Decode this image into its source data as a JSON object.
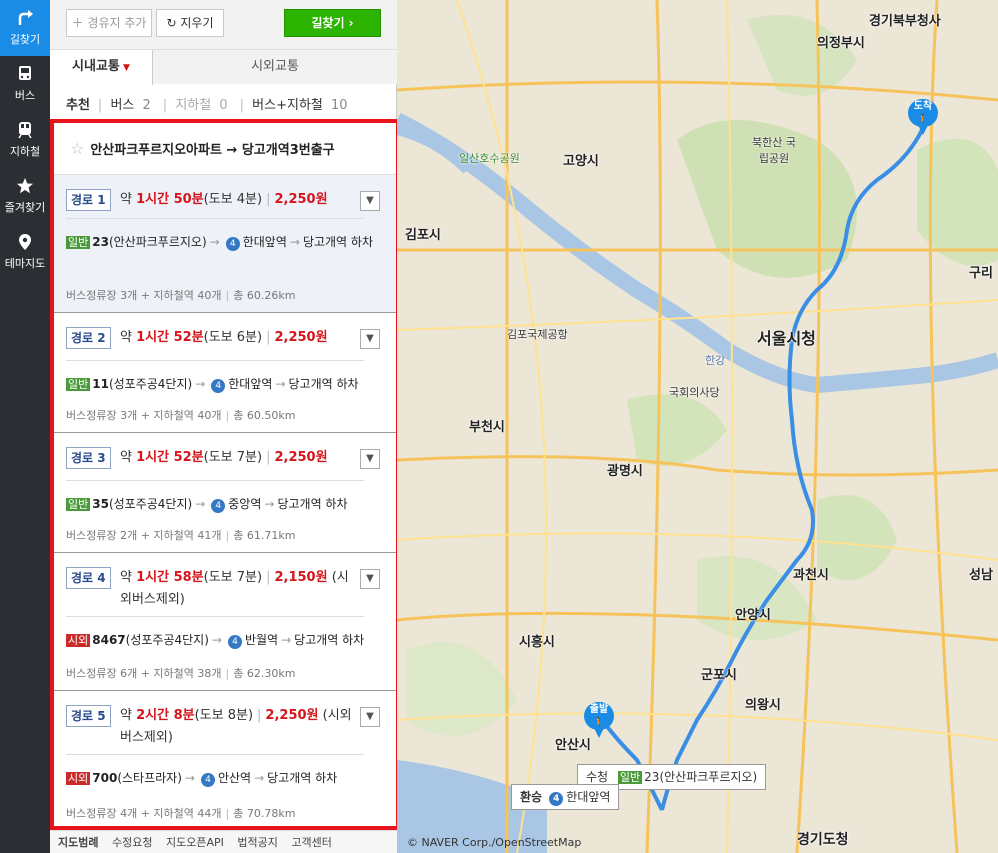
{
  "nav": {
    "items": [
      {
        "label": "길찾기",
        "icon": "route-icon"
      },
      {
        "label": "버스",
        "icon": "bus-icon"
      },
      {
        "label": "지하철",
        "icon": "subway-icon"
      },
      {
        "label": "즐겨찾기",
        "icon": "star-icon"
      },
      {
        "label": "테마지도",
        "icon": "map-pin-icon"
      }
    ]
  },
  "toolbar": {
    "waypoint": "경유지 추가",
    "clear": "지우기",
    "search": "길찾기"
  },
  "tabs": {
    "city": "시내교통",
    "intercity": "시외교통"
  },
  "subtabs": {
    "recommend": "추천",
    "bus_label": "버스",
    "bus_count": "2",
    "subway_label": "지하철",
    "subway_count": "0",
    "busSubway_label": "버스+지하철",
    "busSubway_count": "10"
  },
  "results": {
    "header": "안산파크푸르지오아파트 → 당고개역3번출구",
    "routes": [
      {
        "tag": "경로 1",
        "prefix": "약 ",
        "time": "1시간 50분",
        "walk": "(도보 4분)",
        "fare": "2,250원",
        "extra": "",
        "busType": "일반",
        "busNo": "23",
        "busStop": "(안산파크푸르지오)",
        "line": "4",
        "station": "한대앞역",
        "dest": "당고개역 하차",
        "info1": "버스정류장 3개 + 지하철역 40개",
        "info2": "총 60.26km"
      },
      {
        "tag": "경로 2",
        "prefix": "약 ",
        "time": "1시간 52분",
        "walk": "(도보 6분)",
        "fare": "2,250원",
        "extra": "",
        "busType": "일반",
        "busNo": "11",
        "busStop": "(성포주공4단지)",
        "line": "4",
        "station": "한대앞역",
        "dest": "당고개역 하차",
        "info1": "버스정류장 3개 + 지하철역 40개",
        "info2": "총 60.50km"
      },
      {
        "tag": "경로 3",
        "prefix": "약 ",
        "time": "1시간 52분",
        "walk": "(도보 7분)",
        "fare": "2,250원",
        "extra": "",
        "busType": "일반",
        "busNo": "35",
        "busStop": "(성포주공4단지)",
        "line": "4",
        "station": "중앙역",
        "dest": "당고개역 하차",
        "info1": "버스정류장 2개 + 지하철역 41개",
        "info2": "총 61.71km"
      },
      {
        "tag": "경로 4",
        "prefix": "약 ",
        "time": "1시간 58분",
        "walk": "(도보 7분)",
        "fare": "2,150원",
        "extra": " (시외버스제외)",
        "busType": "시외",
        "busNo": "8467",
        "busStop": "(성포주공4단지)",
        "line": "4",
        "station": "반월역",
        "dest": "당고개역 하차",
        "info1": "버스정류장 6개 + 지하철역 38개",
        "info2": "총 62.30km"
      },
      {
        "tag": "경로 5",
        "prefix": "약 ",
        "time": "2시간 8분",
        "walk": "(도보 8분)",
        "fare": "2,250원",
        "extra": " (시외버스제외)",
        "busType": "시외",
        "busNo": "700",
        "busStop": "(스타프라자)",
        "line": "4",
        "station": "안산역",
        "dest": "당고개역 하차",
        "info1": "버스정류장 4개 + 지하철역 44개",
        "info2": "총 70.78km"
      }
    ]
  },
  "footer": {
    "legend": "지도범례",
    "edit": "수정요청",
    "api": "지도오픈API",
    "legal": "법적공지",
    "support": "고객센터"
  },
  "map": {
    "arrive": "도착",
    "depart": "출발",
    "transfer_label": "환승",
    "transfer_line": "4",
    "transfer_station": "한대앞역",
    "start_callout_type": "일반",
    "start_callout": "23(안산파크푸르지오)",
    "start_callout_prefix": "수청",
    "copyright": "© NAVER Corp./OpenStreetMap",
    "labels": {
      "gyeonggi_north": "경기북부청사",
      "uijeongbu": "의정부시",
      "goyang": "고양시",
      "bukhansan": "북한산\n국립공원",
      "gimpo": "김포시",
      "seoul": "서울시청",
      "bucheon": "부천시",
      "gwangmyeong": "광명시",
      "siheung": "시흥시",
      "anyang": "안양시",
      "gunpo": "군포시",
      "uiwang": "의왕시",
      "ansan": "안산시",
      "gwacheon": "과천시",
      "gyeonggi": "경기도청",
      "seongnam": "성남",
      "guri": "구리",
      "gimpo_airport": "김포국제공항",
      "national_assembly": "국회의사당",
      "ilsan_park": "일산호수공원",
      "hangang": "한강"
    }
  }
}
